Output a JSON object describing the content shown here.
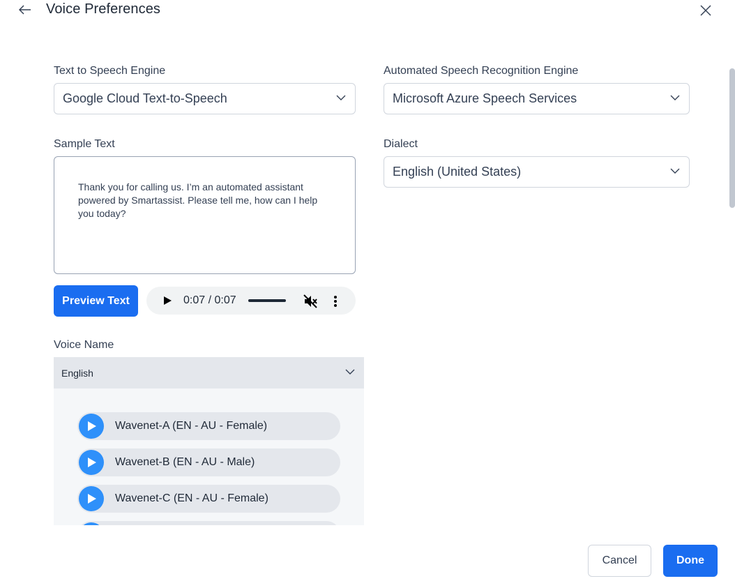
{
  "header": {
    "title": "Voice Preferences",
    "back_icon": "arrow-left-icon",
    "close_icon": "close-icon"
  },
  "tts": {
    "label": "Text to Speech Engine",
    "value": "Google Cloud Text-to-Speech"
  },
  "asr": {
    "label": "Automated Speech Recognition Engine",
    "value": "Microsoft Azure Speech Services"
  },
  "sample": {
    "label": "Sample Text",
    "text": "Thank you for calling us. I’m an automated assistant powered by Smartassist. Please tell me, how can I help you today?"
  },
  "dialect": {
    "label": "Dialect",
    "value": "English (United States)"
  },
  "preview": {
    "button_label": "Preview Text"
  },
  "audio": {
    "time": "0:07 / 0:07",
    "progress": 1.0,
    "muted": true
  },
  "voice": {
    "label": "Voice Name",
    "language": "English",
    "items": [
      {
        "label": "Wavenet-A (EN - AU - Female)"
      },
      {
        "label": "Wavenet-B (EN - AU - Male)"
      },
      {
        "label": "Wavenet-C (EN - AU - Female)"
      }
    ]
  },
  "footer": {
    "cancel_label": "Cancel",
    "done_label": "Done"
  },
  "colors": {
    "primary": "#1a6df0",
    "voice_play": "#2e90fa"
  }
}
